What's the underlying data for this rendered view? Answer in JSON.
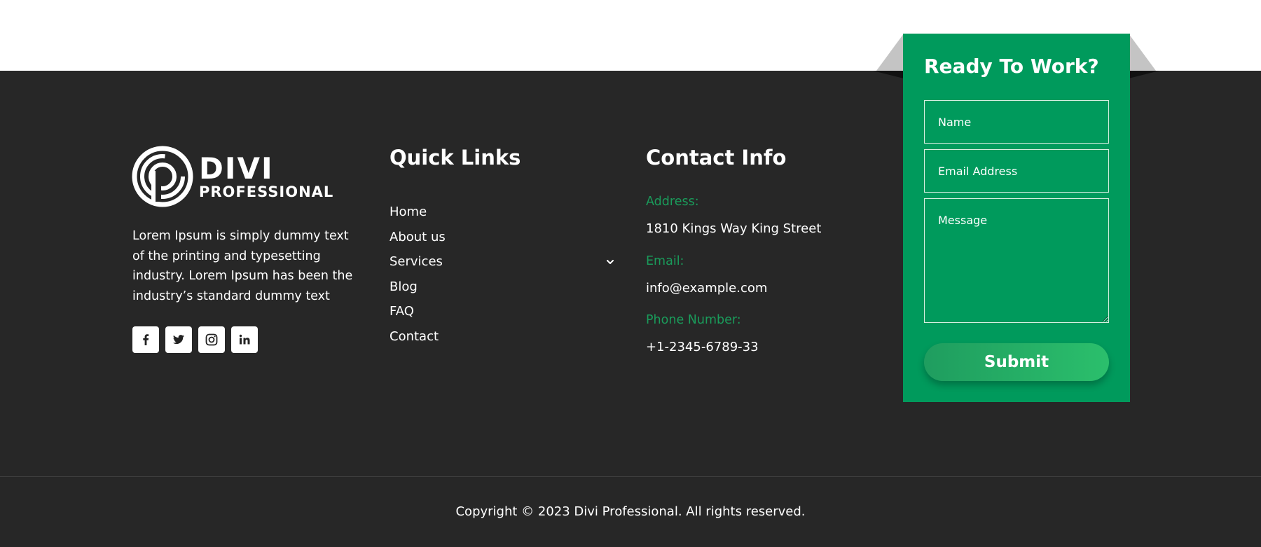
{
  "brand": {
    "logo_line1": "DIVI",
    "logo_line2": "PROFESSIONAL",
    "about": "Lorem Ipsum is simply dummy text of the printing and typesetting industry. Lorem Ipsum has been the industry’s standard dummy text"
  },
  "socials": [
    {
      "icon": "facebook-icon"
    },
    {
      "icon": "twitter-icon"
    },
    {
      "icon": "instagram-icon"
    },
    {
      "icon": "linkedin-icon"
    }
  ],
  "quick_links": {
    "title": "Quick Links",
    "items": [
      {
        "label": "Home"
      },
      {
        "label": "About us"
      },
      {
        "label": "Services"
      },
      {
        "label": "Blog"
      },
      {
        "label": "FAQ"
      },
      {
        "label": "Contact"
      }
    ]
  },
  "contact_info": {
    "title": "Contact Info",
    "address_label": "Address:",
    "address": "1810 Kings Way King Street",
    "email_label": "Email:",
    "email": "info@example.com",
    "phone_label": "Phone Number:",
    "phone": "+1-2345-6789-33"
  },
  "form": {
    "title": "Ready To Work?",
    "name_placeholder": "Name",
    "email_placeholder": "Email Address",
    "message_placeholder": "Message",
    "submit_label": "Submit"
  },
  "footer": {
    "copyright": "Copyright © 2023 Divi Professional. All rights reserved."
  },
  "colors": {
    "footer_bg": "#272727",
    "accent_green": "#009a5c",
    "label_green": "#1a9c5b"
  }
}
